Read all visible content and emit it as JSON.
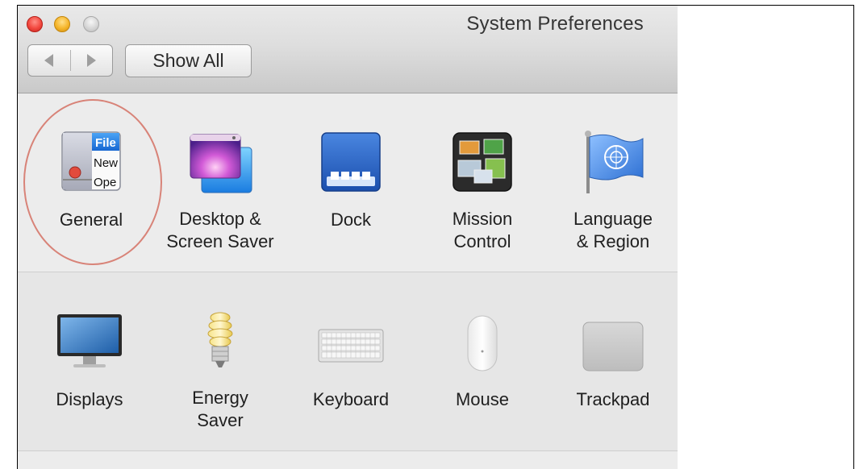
{
  "window": {
    "title": "System Preferences",
    "show_all_label": "Show All"
  },
  "toolbar": {
    "back_icon": "chevron-left-icon",
    "forward_icon": "chevron-right-icon"
  },
  "sections": [
    {
      "items": [
        {
          "label": "General",
          "icon": "general-icon",
          "highlighted": true
        },
        {
          "label": "Desktop &\nScreen Saver",
          "icon": "desktop-screen-saver-icon"
        },
        {
          "label": "Dock",
          "icon": "dock-icon"
        },
        {
          "label": "Mission\nControl",
          "icon": "mission-control-icon"
        },
        {
          "label": "Language\n& Region",
          "icon": "language-region-icon"
        }
      ]
    },
    {
      "items": [
        {
          "label": "Displays",
          "icon": "displays-icon"
        },
        {
          "label": "Energy\nSaver",
          "icon": "energy-saver-icon"
        },
        {
          "label": "Keyboard",
          "icon": "keyboard-icon"
        },
        {
          "label": "Mouse",
          "icon": "mouse-icon"
        },
        {
          "label": "Trackpad",
          "icon": "trackpad-icon"
        }
      ]
    }
  ],
  "general_icon_text": {
    "line1": "File",
    "line2": "New",
    "line3": "Ope"
  },
  "colors": {
    "close": "#f2473e",
    "minimize": "#f5b52a",
    "zoom": "#d3d3d3",
    "highlight": "#d88378"
  }
}
